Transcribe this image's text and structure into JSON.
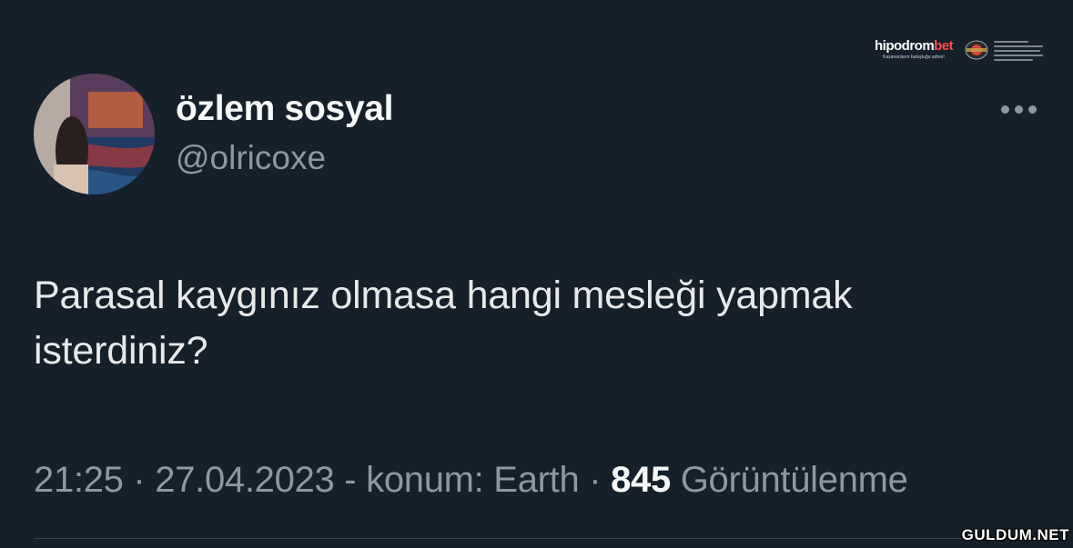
{
  "author": {
    "display_name": "özlem sosyal",
    "handle": "@olricoxe"
  },
  "tweet": {
    "text_line1": "Parasal kaygınız olmasa hangi mesleği yapmak",
    "text_line2": "isterdiniz?"
  },
  "meta": {
    "time": "21:25",
    "separator1": " · ",
    "date": "27.04.2023",
    "location_sep": " - ",
    "location": "konum: Earth",
    "separator2": " · ",
    "views_count": "845",
    "views_label": " Görüntülenme"
  },
  "sponsor": {
    "brand_main": "hipodrom",
    "brand_accent": "bet",
    "tagline": "Kazananların buluştuğu adres!"
  },
  "watermark": "GULDUM.NET",
  "icons": {
    "more": "more-horizontal-icon",
    "seal": "sponsor-seal-icon"
  },
  "colors": {
    "background": "#15202b",
    "text_primary": "#e7e9ea",
    "text_secondary": "#8b98a5",
    "brand_accent": "#ff4b4b"
  }
}
